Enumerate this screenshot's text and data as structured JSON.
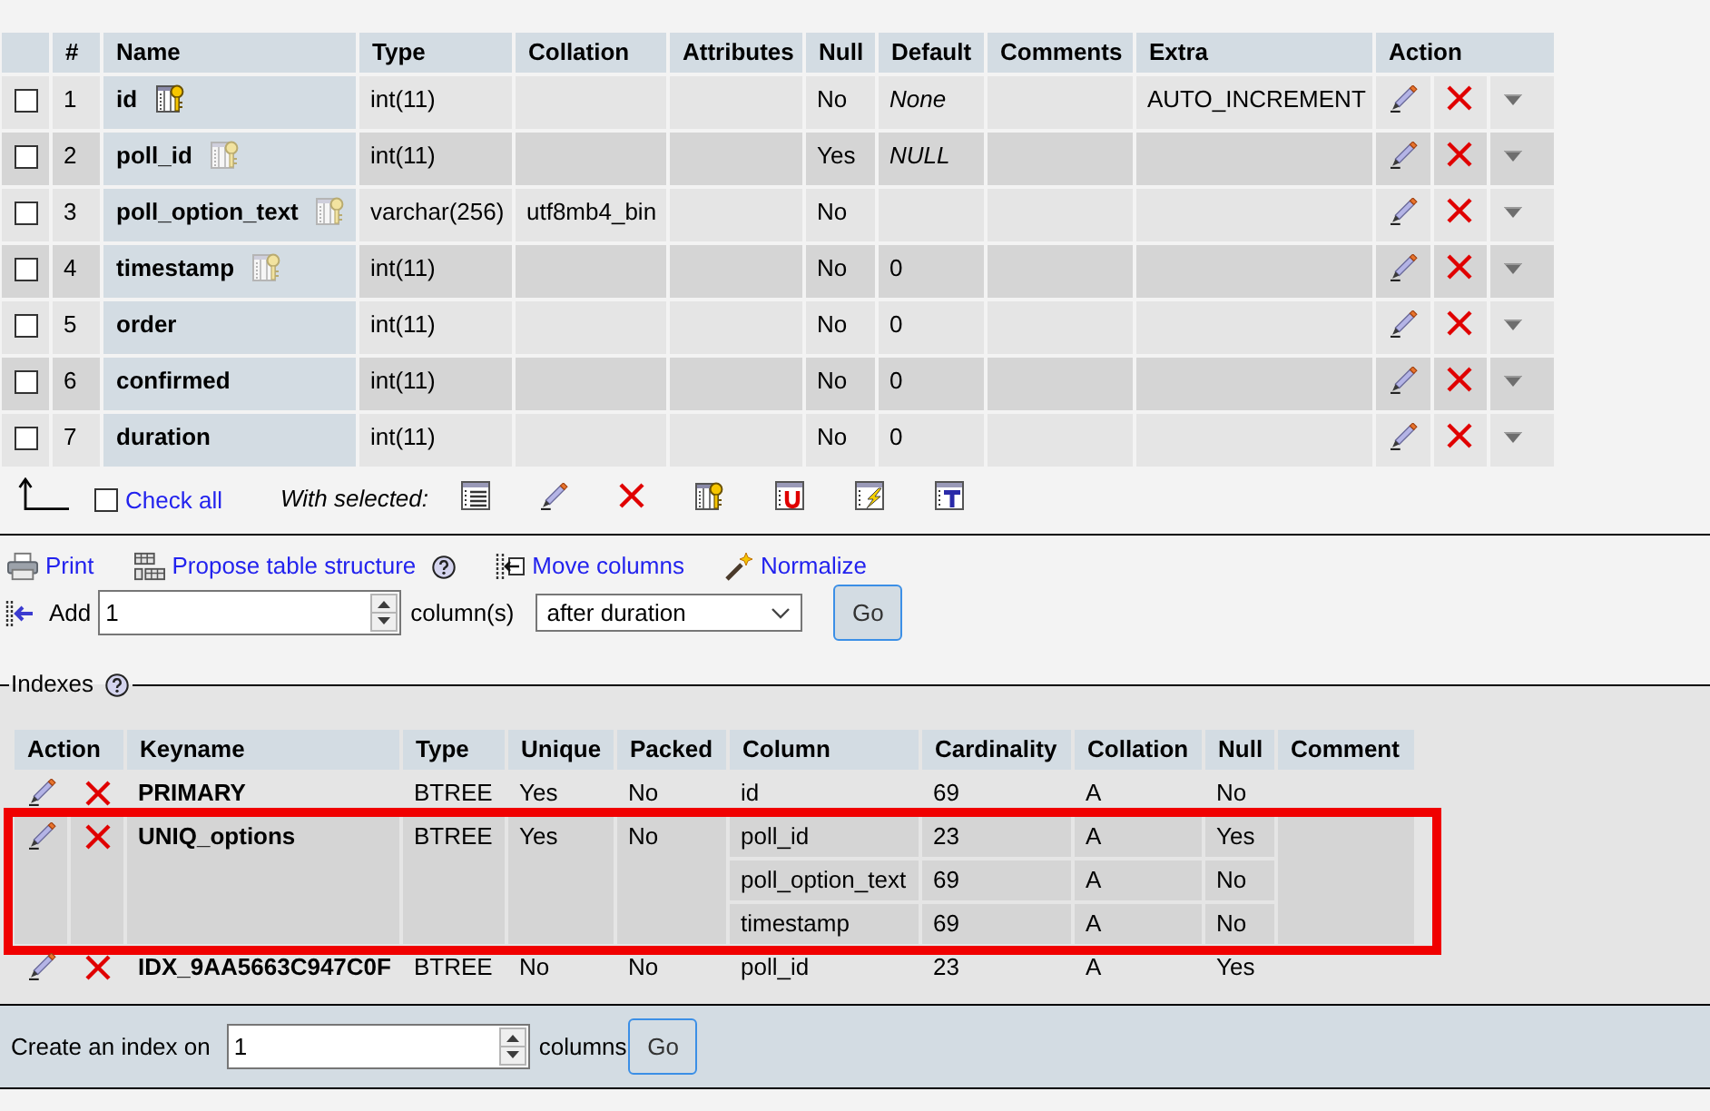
{
  "structure": {
    "columns": [
      "#",
      "Name",
      "Type",
      "Collation",
      "Attributes",
      "Null",
      "Default",
      "Comments",
      "Extra",
      "Action"
    ],
    "rows": [
      {
        "kind": "primary",
        "checked": false,
        "number": "1",
        "name": "id",
        "type": "int(11)",
        "null": "No",
        "default": {
          "value": "None",
          "italic": true
        },
        "extra": "AUTO_INCREMENT"
      },
      {
        "kind": "indexed",
        "checked": false,
        "number": "2",
        "name": "poll_id",
        "type": "int(11)",
        "null": "Yes",
        "default": {
          "value": "NULL",
          "italic": true
        }
      },
      {
        "kind": "indexed",
        "checked": false,
        "number": "3",
        "name": "poll_option_text",
        "type": "varchar(256)",
        "collation": "utf8mb4_bin",
        "null": "No"
      },
      {
        "kind": "indexed",
        "checked": false,
        "number": "4",
        "name": "timestamp",
        "type": "int(11)",
        "null": "No",
        "default": {
          "value": "0",
          "italic": false
        }
      },
      {
        "kind": "plain",
        "checked": false,
        "number": "5",
        "name": "order",
        "type": "int(11)",
        "null": "No",
        "default": {
          "value": "0",
          "italic": false
        }
      },
      {
        "kind": "plain",
        "checked": false,
        "number": "6",
        "name": "confirmed",
        "type": "int(11)",
        "null": "No",
        "default": {
          "value": "0",
          "italic": false
        }
      },
      {
        "kind": "plain",
        "checked": false,
        "number": "7",
        "name": "duration",
        "type": "int(11)",
        "null": "No",
        "default": {
          "value": "0",
          "italic": false
        }
      }
    ]
  },
  "bulk_actions": {
    "check_all": {
      "label": "Check all",
      "checked": false
    },
    "with_selected": "With selected:"
  },
  "table_links": [
    {
      "kind": "print",
      "label": "Print",
      "help": false
    },
    {
      "kind": "propose",
      "label": "Propose table structure",
      "help": true
    },
    {
      "kind": "move",
      "label": "Move columns",
      "help": false
    },
    {
      "kind": "normalize",
      "label": "Normalize",
      "help": false
    }
  ],
  "add_columns": {
    "label": "Add",
    "count": "1",
    "unit": "column(s)",
    "position": "after duration",
    "button": "Go"
  },
  "indexes": {
    "legend": "Indexes",
    "columns": [
      "Action",
      "Keyname",
      "Type",
      "Unique",
      "Packed",
      "Column",
      "Cardinality",
      "Collation",
      "Null",
      "Comment"
    ],
    "rows": [
      {
        "keyname": "PRIMARY",
        "type": "BTREE",
        "unique": "Yes",
        "packed": "No",
        "highlighted": false,
        "columns": [
          {
            "column": "id",
            "cardinality": "69",
            "collation": "A",
            "null": "No"
          }
        ]
      },
      {
        "keyname": "UNIQ_options",
        "type": "BTREE",
        "unique": "Yes",
        "packed": "No",
        "highlighted": true,
        "columns": [
          {
            "column": "poll_id",
            "cardinality": "23",
            "collation": "A",
            "null": "Yes"
          },
          {
            "column": "poll_option_text",
            "cardinality": "69",
            "collation": "A",
            "null": "No"
          },
          {
            "column": "timestamp",
            "cardinality": "69",
            "collation": "A",
            "null": "No"
          }
        ]
      },
      {
        "keyname": "IDX_9AA5663C947C0F",
        "type": "BTREE",
        "unique": "No",
        "packed": "No",
        "highlighted": false,
        "columns": [
          {
            "column": "poll_id",
            "cardinality": "23",
            "collation": "A",
            "null": "Yes"
          }
        ]
      }
    ]
  },
  "create_index": {
    "label": "Create an index on",
    "count": "1",
    "unit": "columns",
    "button": "Go"
  }
}
